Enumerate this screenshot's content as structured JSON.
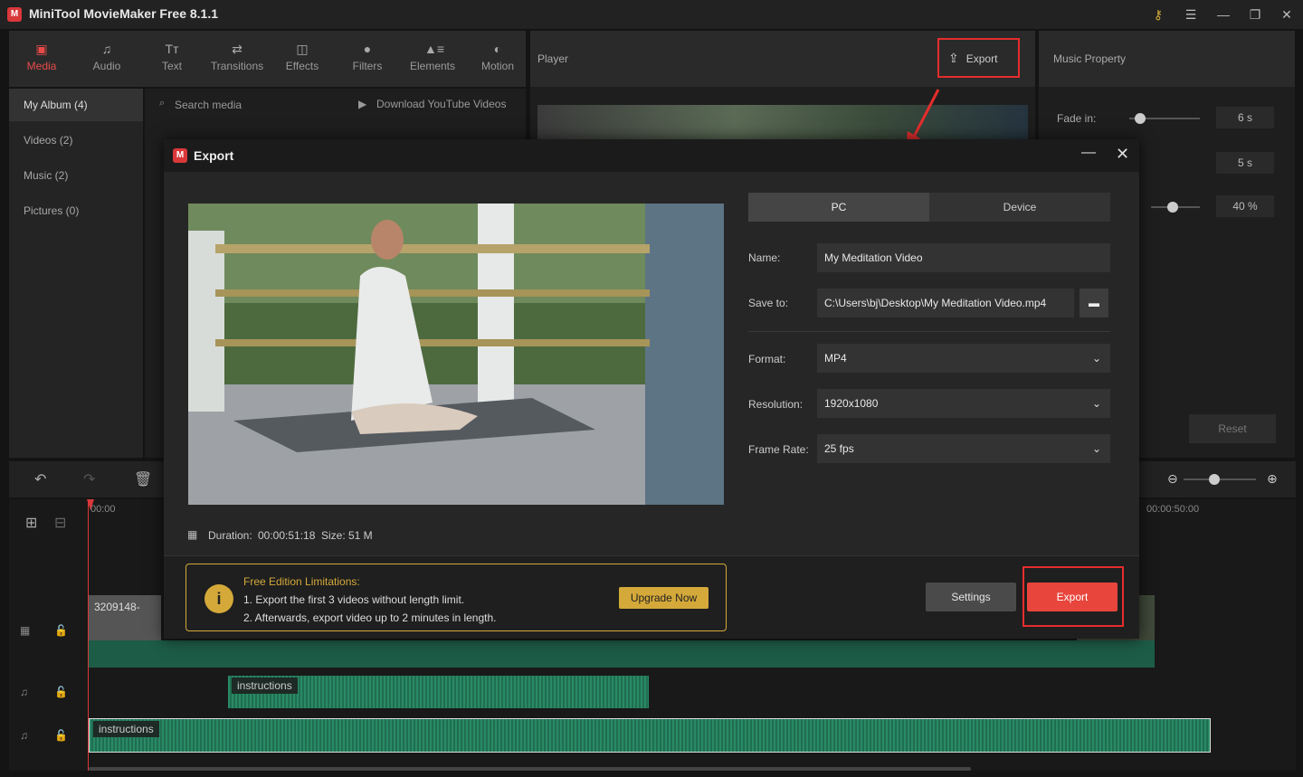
{
  "app": {
    "title": "MiniTool MovieMaker Free 8.1.1",
    "logo": "M"
  },
  "toolbar": {
    "items": [
      {
        "label": "Media",
        "icon": "media-icon"
      },
      {
        "label": "Audio",
        "icon": "music-note-icon"
      },
      {
        "label": "Text",
        "icon": "text-icon"
      },
      {
        "label": "Transitions",
        "icon": "transitions-icon"
      },
      {
        "label": "Effects",
        "icon": "effects-icon"
      },
      {
        "label": "Filters",
        "icon": "filters-icon"
      },
      {
        "label": "Elements",
        "icon": "elements-icon"
      },
      {
        "label": "Motion",
        "icon": "motion-icon"
      }
    ]
  },
  "sidebar": {
    "items": [
      {
        "label": "My Album (4)"
      },
      {
        "label": "Videos (2)"
      },
      {
        "label": "Music (2)"
      },
      {
        "label": "Pictures (0)"
      }
    ]
  },
  "media": {
    "search_placeholder": "Search media",
    "download_label": "Download YouTube Videos"
  },
  "player": {
    "title": "Player",
    "export_label": "Export"
  },
  "music_property": {
    "title": "Music Property",
    "fade_in_label": "Fade in:",
    "fade_in_value": "6 s",
    "fade_out_value": "5 s",
    "volume_value": "40 %",
    "reset_label": "Reset"
  },
  "timeline": {
    "time_start": "00:00",
    "time_end": "00:00:50:00",
    "video_clip_label": "3209148-",
    "audio_clip_1": "instructions",
    "audio_clip_2": "instructions"
  },
  "export_dialog": {
    "title": "Export",
    "tabs": [
      "PC",
      "Device"
    ],
    "name_label": "Name:",
    "name_value": "My Meditation Video",
    "save_label": "Save to:",
    "save_value": "C:\\Users\\bj\\Desktop\\My Meditation Video.mp4",
    "format_label": "Format:",
    "format_value": "MP4",
    "resolution_label": "Resolution:",
    "resolution_value": "1920x1080",
    "framerate_label": "Frame Rate:",
    "framerate_value": "25 fps",
    "duration_label": "Duration:",
    "duration_value": "00:00:51:18",
    "size_label": "Size:",
    "size_value": "51 M",
    "limitations_title": "Free Edition Limitations:",
    "limitation_1": "1. Export the first 3 videos without length limit.",
    "limitation_2": "2. Afterwards, export video up to 2 minutes in length.",
    "upgrade_label": "Upgrade Now",
    "settings_label": "Settings",
    "export_label": "Export"
  },
  "colors": {
    "accent_red": "#e8453c",
    "highlight": "#e52d2d",
    "gold": "#d4a93a"
  }
}
